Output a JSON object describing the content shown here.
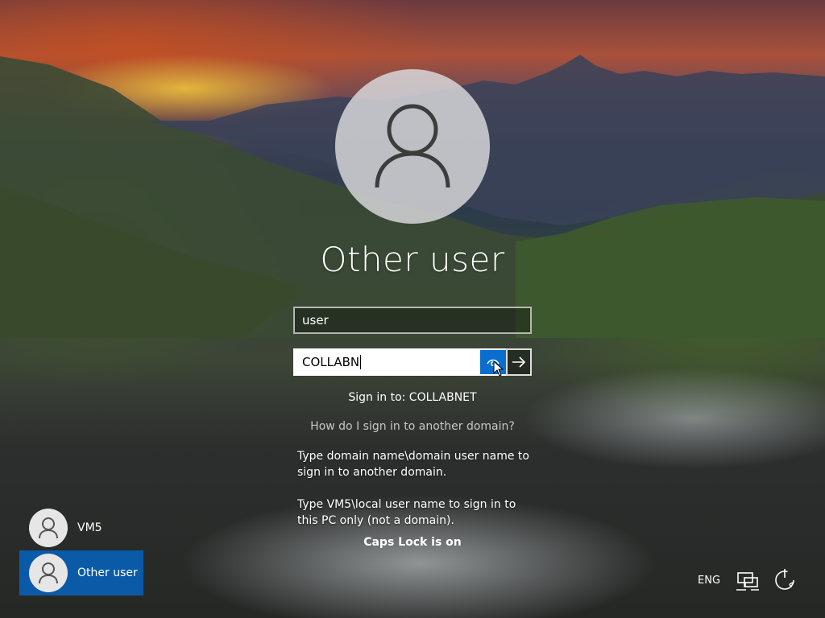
{
  "login": {
    "title": "Other user",
    "username_value": "user",
    "password_value": "COLLABN",
    "reveal_icon": "eye-icon",
    "submit_icon": "arrow-right-icon",
    "sign_in_to": "Sign in to: COLLABNET",
    "help_link": "How do I sign in to another domain?",
    "hint_domain": "Type domain name\\domain user name to sign in to another domain.",
    "hint_local": "Type VM5\\local user name to sign in to this PC only (not a domain).",
    "caps_lock": "Caps Lock is on"
  },
  "users": [
    {
      "name": "VM5",
      "icon": "user-avatar-icon"
    },
    {
      "name": "Other user",
      "icon": "user-avatar-icon",
      "selected": true
    }
  ],
  "tray": {
    "language": "ENG",
    "network_icon": "network-icon",
    "power_icon": "power-icon"
  },
  "colors": {
    "accent": "#0a6ecf",
    "selected_tile": "#0a5aa8"
  }
}
